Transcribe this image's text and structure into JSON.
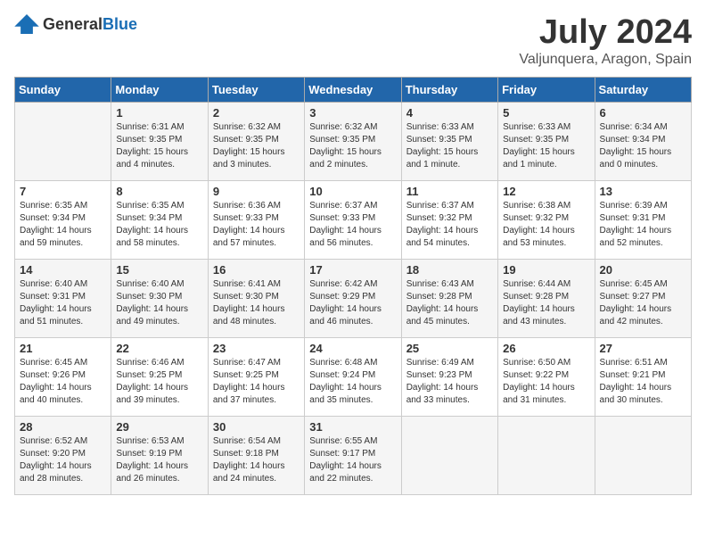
{
  "header": {
    "logo": {
      "text_general": "General",
      "text_blue": "Blue"
    },
    "title": "July 2024",
    "location": "Valjunquera, Aragon, Spain"
  },
  "calendar": {
    "days_of_week": [
      "Sunday",
      "Monday",
      "Tuesday",
      "Wednesday",
      "Thursday",
      "Friday",
      "Saturday"
    ],
    "weeks": [
      [
        {
          "day": "",
          "sunrise": "",
          "sunset": "",
          "daylight": ""
        },
        {
          "day": "1",
          "sunrise": "Sunrise: 6:31 AM",
          "sunset": "Sunset: 9:35 PM",
          "daylight": "Daylight: 15 hours and 4 minutes."
        },
        {
          "day": "2",
          "sunrise": "Sunrise: 6:32 AM",
          "sunset": "Sunset: 9:35 PM",
          "daylight": "Daylight: 15 hours and 3 minutes."
        },
        {
          "day": "3",
          "sunrise": "Sunrise: 6:32 AM",
          "sunset": "Sunset: 9:35 PM",
          "daylight": "Daylight: 15 hours and 2 minutes."
        },
        {
          "day": "4",
          "sunrise": "Sunrise: 6:33 AM",
          "sunset": "Sunset: 9:35 PM",
          "daylight": "Daylight: 15 hours and 1 minute."
        },
        {
          "day": "5",
          "sunrise": "Sunrise: 6:33 AM",
          "sunset": "Sunset: 9:35 PM",
          "daylight": "Daylight: 15 hours and 1 minute."
        },
        {
          "day": "6",
          "sunrise": "Sunrise: 6:34 AM",
          "sunset": "Sunset: 9:34 PM",
          "daylight": "Daylight: 15 hours and 0 minutes."
        }
      ],
      [
        {
          "day": "7",
          "sunrise": "Sunrise: 6:35 AM",
          "sunset": "Sunset: 9:34 PM",
          "daylight": "Daylight: 14 hours and 59 minutes."
        },
        {
          "day": "8",
          "sunrise": "Sunrise: 6:35 AM",
          "sunset": "Sunset: 9:34 PM",
          "daylight": "Daylight: 14 hours and 58 minutes."
        },
        {
          "day": "9",
          "sunrise": "Sunrise: 6:36 AM",
          "sunset": "Sunset: 9:33 PM",
          "daylight": "Daylight: 14 hours and 57 minutes."
        },
        {
          "day": "10",
          "sunrise": "Sunrise: 6:37 AM",
          "sunset": "Sunset: 9:33 PM",
          "daylight": "Daylight: 14 hours and 56 minutes."
        },
        {
          "day": "11",
          "sunrise": "Sunrise: 6:37 AM",
          "sunset": "Sunset: 9:32 PM",
          "daylight": "Daylight: 14 hours and 54 minutes."
        },
        {
          "day": "12",
          "sunrise": "Sunrise: 6:38 AM",
          "sunset": "Sunset: 9:32 PM",
          "daylight": "Daylight: 14 hours and 53 minutes."
        },
        {
          "day": "13",
          "sunrise": "Sunrise: 6:39 AM",
          "sunset": "Sunset: 9:31 PM",
          "daylight": "Daylight: 14 hours and 52 minutes."
        }
      ],
      [
        {
          "day": "14",
          "sunrise": "Sunrise: 6:40 AM",
          "sunset": "Sunset: 9:31 PM",
          "daylight": "Daylight: 14 hours and 51 minutes."
        },
        {
          "day": "15",
          "sunrise": "Sunrise: 6:40 AM",
          "sunset": "Sunset: 9:30 PM",
          "daylight": "Daylight: 14 hours and 49 minutes."
        },
        {
          "day": "16",
          "sunrise": "Sunrise: 6:41 AM",
          "sunset": "Sunset: 9:30 PM",
          "daylight": "Daylight: 14 hours and 48 minutes."
        },
        {
          "day": "17",
          "sunrise": "Sunrise: 6:42 AM",
          "sunset": "Sunset: 9:29 PM",
          "daylight": "Daylight: 14 hours and 46 minutes."
        },
        {
          "day": "18",
          "sunrise": "Sunrise: 6:43 AM",
          "sunset": "Sunset: 9:28 PM",
          "daylight": "Daylight: 14 hours and 45 minutes."
        },
        {
          "day": "19",
          "sunrise": "Sunrise: 6:44 AM",
          "sunset": "Sunset: 9:28 PM",
          "daylight": "Daylight: 14 hours and 43 minutes."
        },
        {
          "day": "20",
          "sunrise": "Sunrise: 6:45 AM",
          "sunset": "Sunset: 9:27 PM",
          "daylight": "Daylight: 14 hours and 42 minutes."
        }
      ],
      [
        {
          "day": "21",
          "sunrise": "Sunrise: 6:45 AM",
          "sunset": "Sunset: 9:26 PM",
          "daylight": "Daylight: 14 hours and 40 minutes."
        },
        {
          "day": "22",
          "sunrise": "Sunrise: 6:46 AM",
          "sunset": "Sunset: 9:25 PM",
          "daylight": "Daylight: 14 hours and 39 minutes."
        },
        {
          "day": "23",
          "sunrise": "Sunrise: 6:47 AM",
          "sunset": "Sunset: 9:25 PM",
          "daylight": "Daylight: 14 hours and 37 minutes."
        },
        {
          "day": "24",
          "sunrise": "Sunrise: 6:48 AM",
          "sunset": "Sunset: 9:24 PM",
          "daylight": "Daylight: 14 hours and 35 minutes."
        },
        {
          "day": "25",
          "sunrise": "Sunrise: 6:49 AM",
          "sunset": "Sunset: 9:23 PM",
          "daylight": "Daylight: 14 hours and 33 minutes."
        },
        {
          "day": "26",
          "sunrise": "Sunrise: 6:50 AM",
          "sunset": "Sunset: 9:22 PM",
          "daylight": "Daylight: 14 hours and 31 minutes."
        },
        {
          "day": "27",
          "sunrise": "Sunrise: 6:51 AM",
          "sunset": "Sunset: 9:21 PM",
          "daylight": "Daylight: 14 hours and 30 minutes."
        }
      ],
      [
        {
          "day": "28",
          "sunrise": "Sunrise: 6:52 AM",
          "sunset": "Sunset: 9:20 PM",
          "daylight": "Daylight: 14 hours and 28 minutes."
        },
        {
          "day": "29",
          "sunrise": "Sunrise: 6:53 AM",
          "sunset": "Sunset: 9:19 PM",
          "daylight": "Daylight: 14 hours and 26 minutes."
        },
        {
          "day": "30",
          "sunrise": "Sunrise: 6:54 AM",
          "sunset": "Sunset: 9:18 PM",
          "daylight": "Daylight: 14 hours and 24 minutes."
        },
        {
          "day": "31",
          "sunrise": "Sunrise: 6:55 AM",
          "sunset": "Sunset: 9:17 PM",
          "daylight": "Daylight: 14 hours and 22 minutes."
        },
        {
          "day": "",
          "sunrise": "",
          "sunset": "",
          "daylight": ""
        },
        {
          "day": "",
          "sunrise": "",
          "sunset": "",
          "daylight": ""
        },
        {
          "day": "",
          "sunrise": "",
          "sunset": "",
          "daylight": ""
        }
      ]
    ]
  }
}
